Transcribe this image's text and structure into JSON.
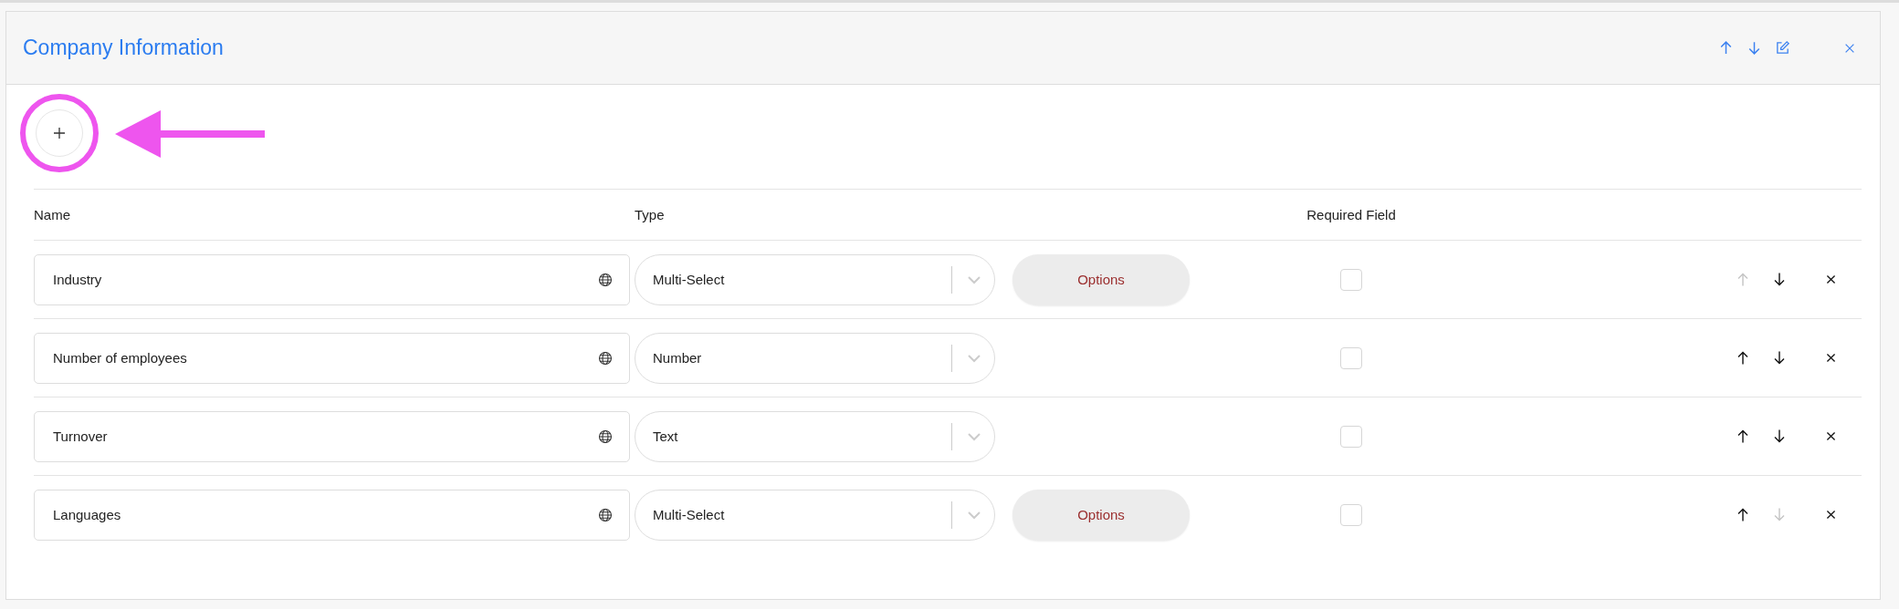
{
  "panel": {
    "title": "Company Information"
  },
  "columns": [
    "Name",
    "Type",
    "Required Field"
  ],
  "rows": [
    {
      "name": "Industry",
      "type": "Multi-Select",
      "options_label": "Options",
      "required": false,
      "up_disabled": true,
      "down_disabled": false
    },
    {
      "name": "Number of employees",
      "type": "Number",
      "required": false,
      "up_disabled": false,
      "down_disabled": false
    },
    {
      "name": "Turnover",
      "type": "Text",
      "required": false,
      "up_disabled": false,
      "down_disabled": false
    },
    {
      "name": "Languages",
      "type": "Multi-Select",
      "options_label": "Options",
      "required": false,
      "up_disabled": false,
      "down_disabled": true
    }
  ]
}
